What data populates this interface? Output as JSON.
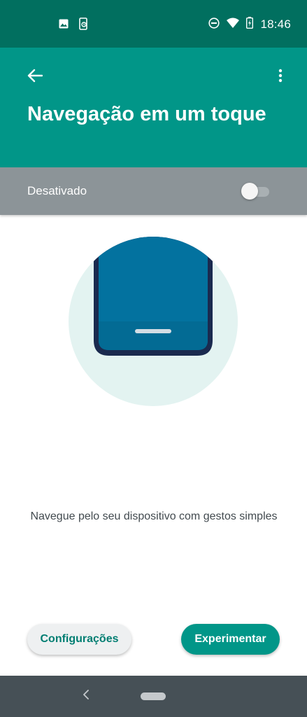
{
  "status_bar": {
    "time": "18:46",
    "left_icons": [
      "image-icon",
      "phone-sync-icon"
    ],
    "right_icons": [
      "do-not-disturb-icon",
      "wifi-icon",
      "battery-charging-icon"
    ]
  },
  "app_bar": {
    "title": "Navegação em um toque",
    "back_icon": "arrow-back-icon",
    "menu_icon": "more-vert-icon"
  },
  "toggle": {
    "label": "Desativado",
    "enabled": false
  },
  "main": {
    "description": "Navegue pelo seu dispositivo com gestos simples"
  },
  "actions": {
    "settings_label": "Configurações",
    "try_label": "Experimentar"
  },
  "nav_bar": {
    "icons": [
      "nav-back-icon",
      "nav-home-pill-icon"
    ]
  },
  "colors": {
    "status_bar": "#016f5f",
    "primary": "#019688",
    "toggle_row": "#8c9498",
    "nav_bar": "#465056",
    "illustration_circle": "#e3f3f1",
    "phone_screen": "#03729f",
    "phone_frame": "#1a2a4f"
  }
}
